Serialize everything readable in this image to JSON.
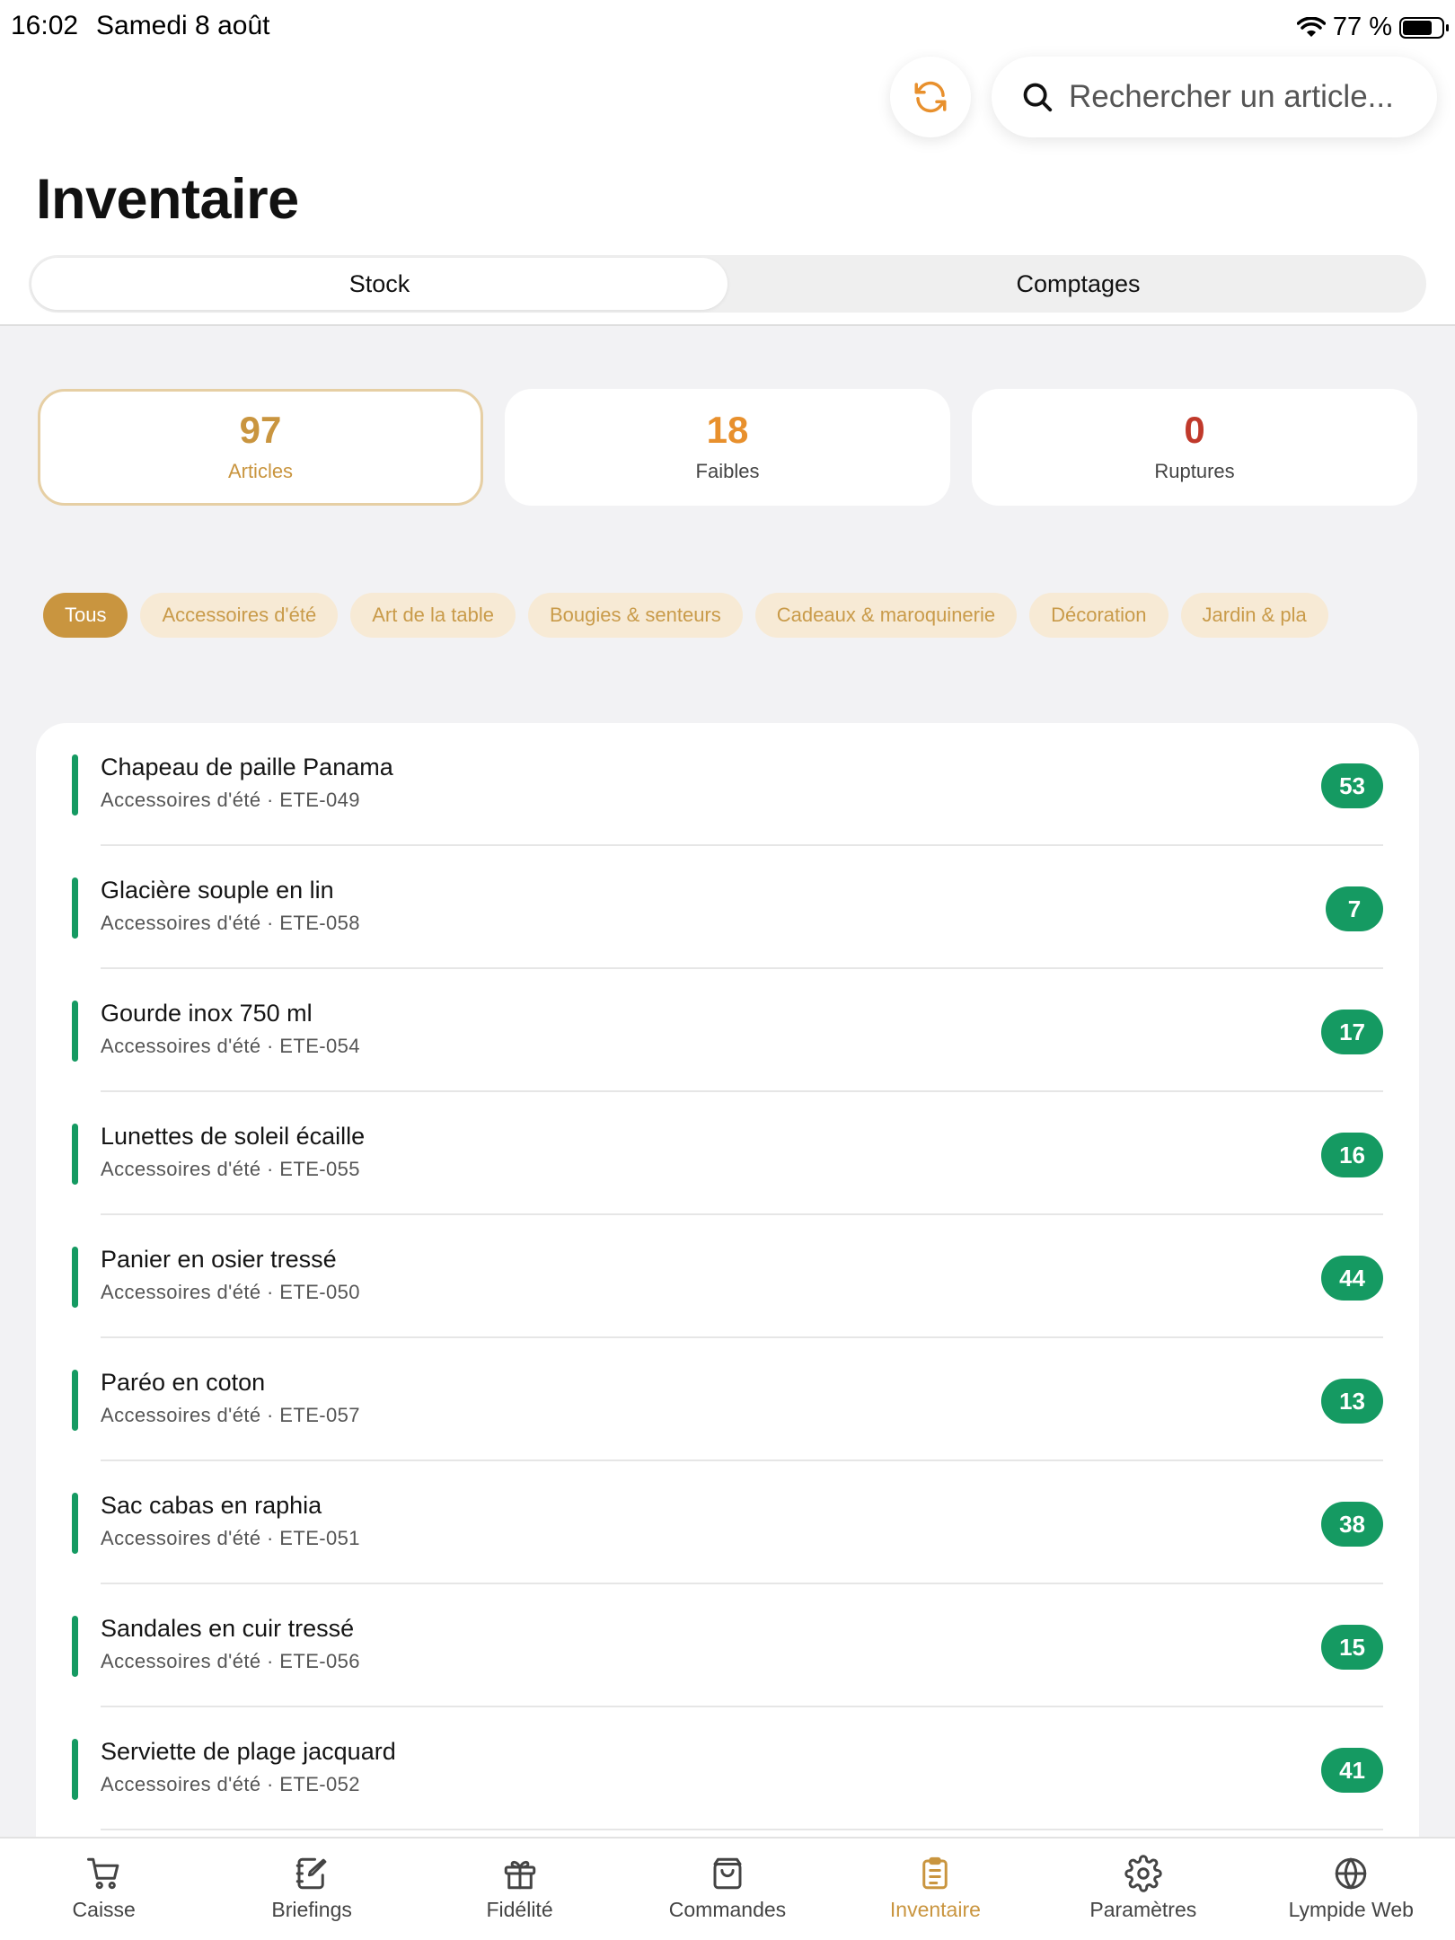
{
  "status_bar": {
    "time": "16:02",
    "date": "Samedi 8 août",
    "battery": "77 %"
  },
  "search": {
    "placeholder": "Rechercher un article..."
  },
  "page_title": "Inventaire",
  "segments": [
    {
      "label": "Stock",
      "active": true
    },
    {
      "label": "Comptages",
      "active": false
    }
  ],
  "stats": [
    {
      "value": "97",
      "label": "Articles",
      "color": "#c9953f",
      "selected": true
    },
    {
      "value": "18",
      "label": "Faibles",
      "color": "#e8902d",
      "selected": false
    },
    {
      "value": "0",
      "label": "Ruptures",
      "color": "#c0392b",
      "selected": false
    }
  ],
  "filters": [
    {
      "label": "Tous",
      "active": true
    },
    {
      "label": "Accessoires d'été",
      "active": false
    },
    {
      "label": "Art de la table",
      "active": false
    },
    {
      "label": "Bougies & senteurs",
      "active": false
    },
    {
      "label": "Cadeaux & maroquinerie",
      "active": false
    },
    {
      "label": "Décoration",
      "active": false
    },
    {
      "label": "Jardin & pla",
      "active": false
    }
  ],
  "items": [
    {
      "name": "Chapeau de paille Panama",
      "meta": "Accessoires d'été · ETE-049",
      "count": "53"
    },
    {
      "name": "Glacière souple en lin",
      "meta": "Accessoires d'été · ETE-058",
      "count": "7"
    },
    {
      "name": "Gourde inox 750 ml",
      "meta": "Accessoires d'été · ETE-054",
      "count": "17"
    },
    {
      "name": "Lunettes de soleil écaille",
      "meta": "Accessoires d'été · ETE-055",
      "count": "16"
    },
    {
      "name": "Panier en osier tressé",
      "meta": "Accessoires d'été · ETE-050",
      "count": "44"
    },
    {
      "name": "Paréo en coton",
      "meta": "Accessoires d'été · ETE-057",
      "count": "13"
    },
    {
      "name": "Sac cabas en raphia",
      "meta": "Accessoires d'été · ETE-051",
      "count": "38"
    },
    {
      "name": "Sandales en cuir tressé",
      "meta": "Accessoires d'été · ETE-056",
      "count": "15"
    },
    {
      "name": "Serviette de plage jacquard",
      "meta": "Accessoires d'été · ETE-052",
      "count": "41"
    }
  ],
  "tabs": [
    {
      "label": "Caisse",
      "icon": "cart-icon",
      "active": false
    },
    {
      "label": "Briefings",
      "icon": "notebook-edit-icon",
      "active": false
    },
    {
      "label": "Fidélité",
      "icon": "gift-icon",
      "active": false
    },
    {
      "label": "Commandes",
      "icon": "shopping-bag-icon",
      "active": false
    },
    {
      "label": "Inventaire",
      "icon": "clipboard-list-icon",
      "active": true
    },
    {
      "label": "Paramètres",
      "icon": "gear-icon",
      "active": false
    },
    {
      "label": "Lympide Web",
      "icon": "globe-icon",
      "active": false
    }
  ],
  "colors": {
    "accent": "#c9953f",
    "stock_ok": "#159a62",
    "low": "#e8902d",
    "out": "#c0392b",
    "chip_bg": "#f7ead5"
  }
}
